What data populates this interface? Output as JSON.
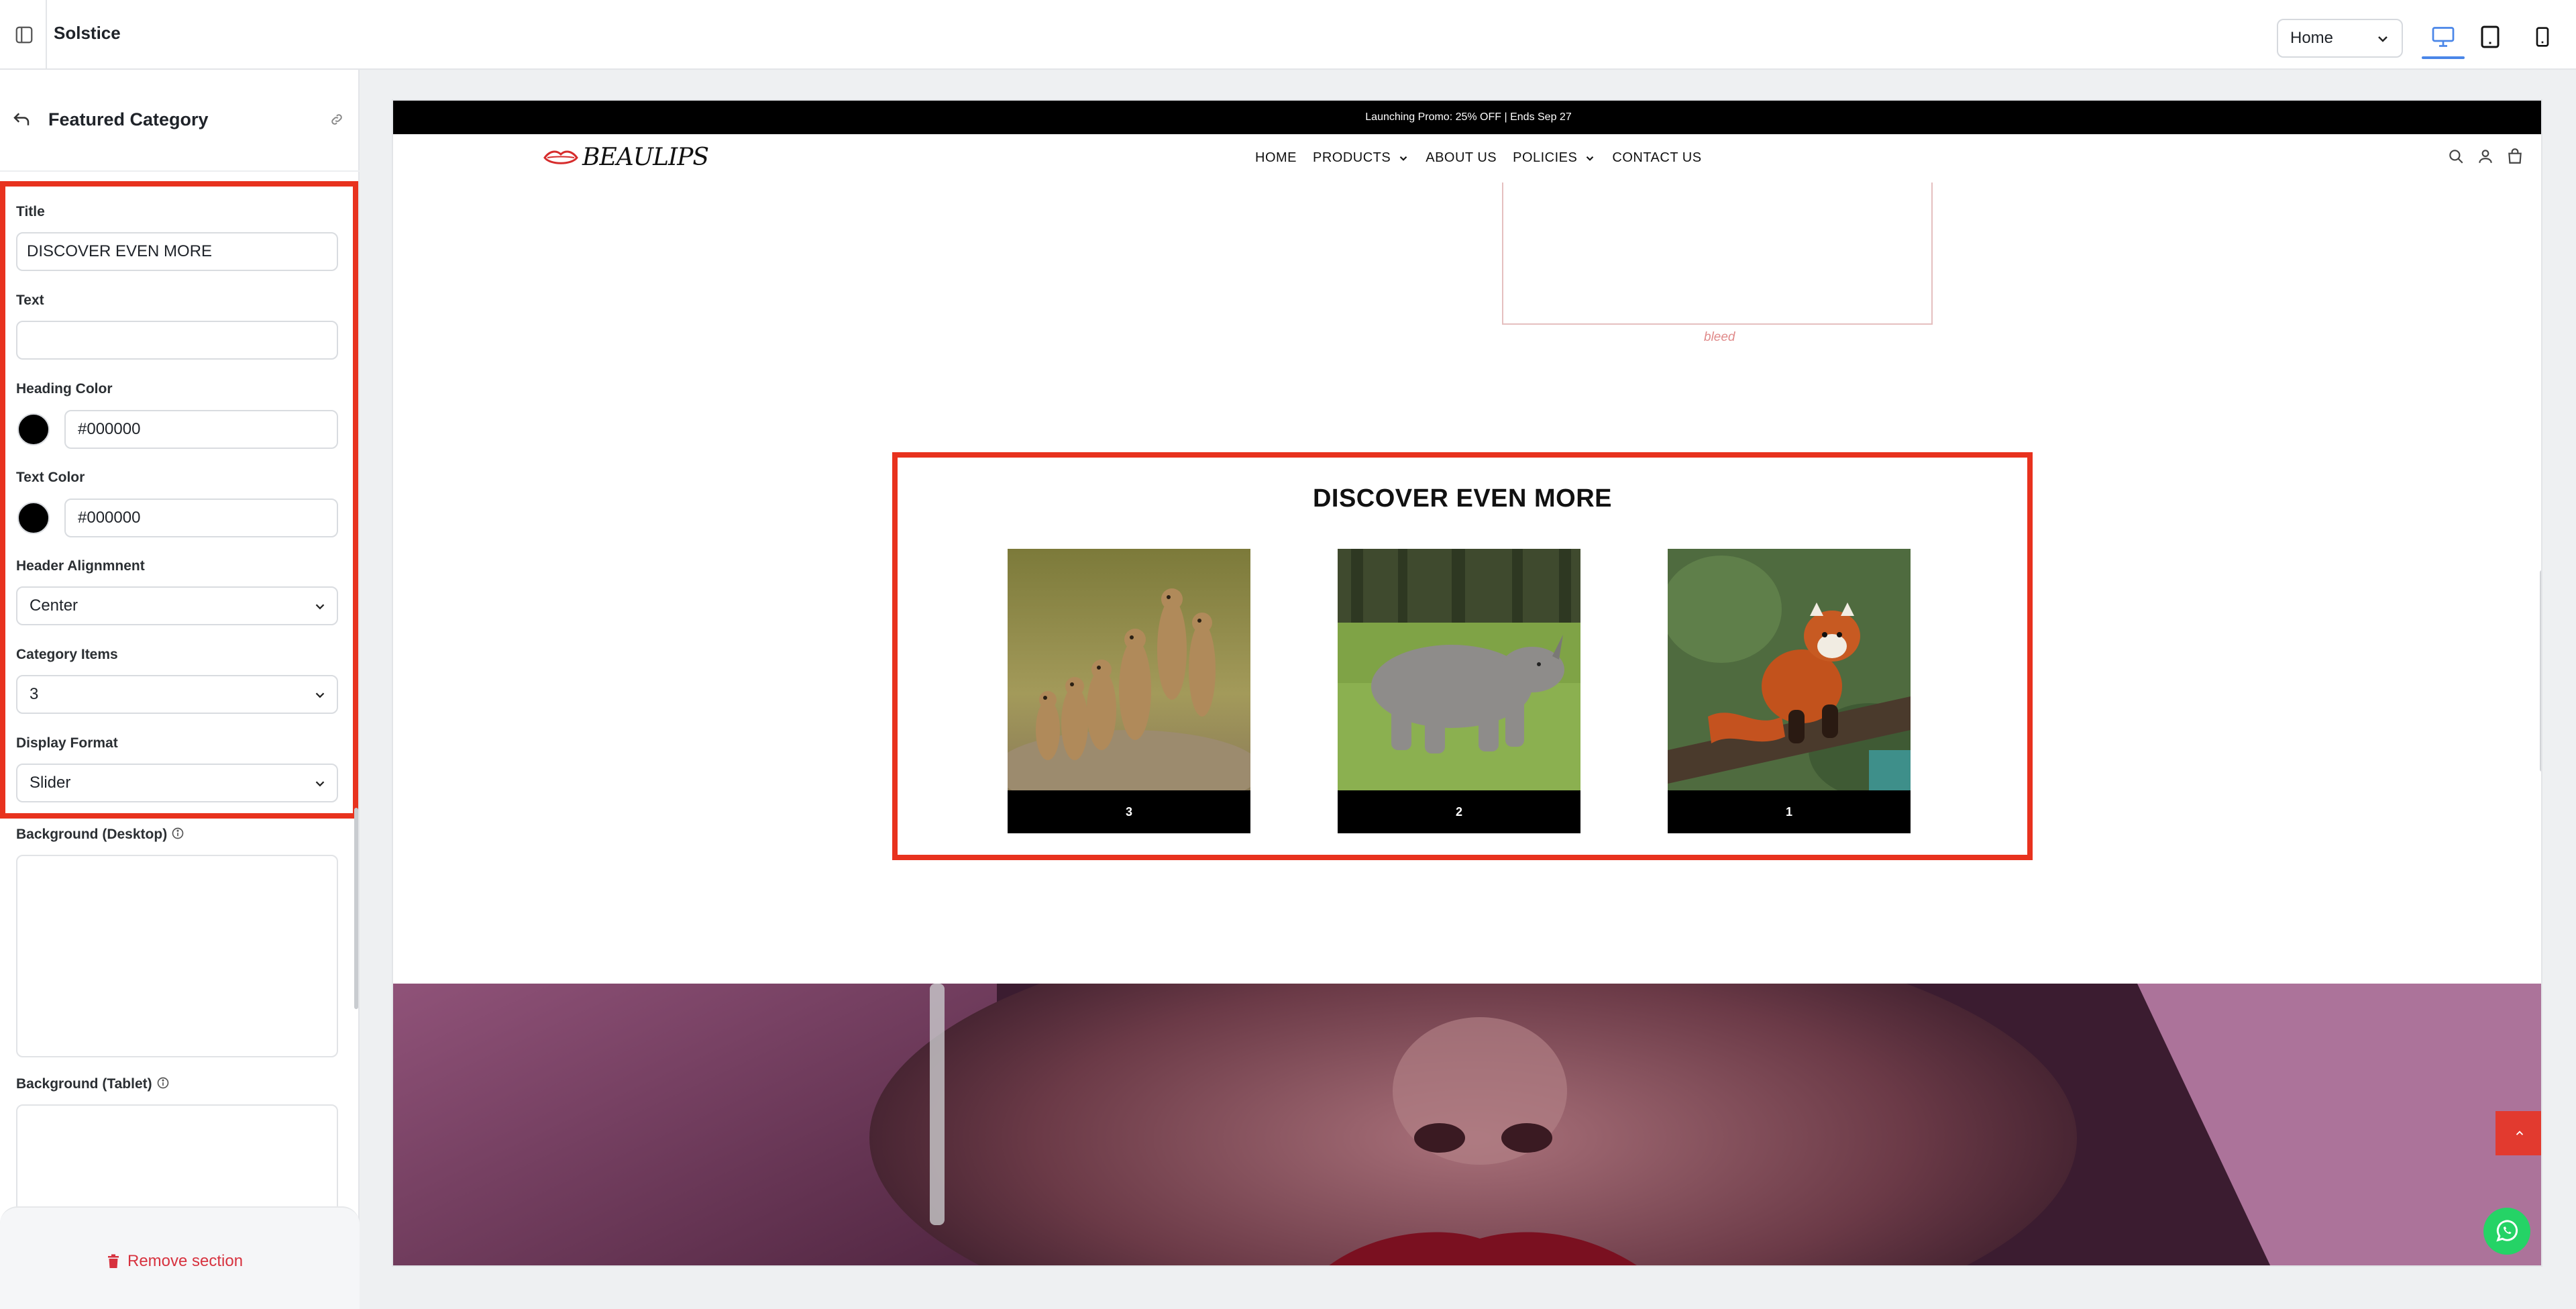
{
  "app": {
    "title": "Solstice",
    "page_selector": {
      "selected": "Home"
    },
    "devices": [
      {
        "name": "desktop",
        "active": true
      },
      {
        "name": "tablet",
        "active": false
      },
      {
        "name": "mobile",
        "active": false
      }
    ]
  },
  "panel": {
    "title": "Featured Category",
    "fields": {
      "title": {
        "label": "Title",
        "value": "DISCOVER EVEN MORE"
      },
      "text": {
        "label": "Text",
        "value": ""
      },
      "heading_color": {
        "label": "Heading Color",
        "value": "#000000",
        "swatch": "#000000"
      },
      "text_color": {
        "label": "Text Color",
        "value": "#000000",
        "swatch": "#000000"
      },
      "header_alignment": {
        "label": "Header Alignmnent",
        "value": "Center"
      },
      "category_items": {
        "label": "Category Items",
        "value": "3"
      },
      "display_format": {
        "label": "Display Format",
        "value": "Slider"
      },
      "background_desktop": {
        "label": "Background (Desktop)"
      },
      "background_tablet": {
        "label": "Background (Tablet)"
      }
    },
    "footer": {
      "remove_label": "Remove section"
    },
    "highlight_color": "#e8321e"
  },
  "preview": {
    "promo": "Launching Promo: 25% OFF | Ends Sep 27",
    "logo": "BEAULIPS",
    "nav": {
      "home": "HOME",
      "products": "PRODUCTS",
      "about": "ABOUT US",
      "policies": "POLICIES",
      "contact": "CONTACT US"
    },
    "embed_caption": "bleed",
    "featured": {
      "title": "DISCOVER EVEN MORE",
      "cards": [
        {
          "label": "3",
          "image": "meerkats"
        },
        {
          "label": "2",
          "image": "rhinoceros"
        },
        {
          "label": "1",
          "image": "red-panda"
        }
      ]
    },
    "colors": {
      "accent": "#e23a2f",
      "whatsapp": "#25d366"
    }
  }
}
